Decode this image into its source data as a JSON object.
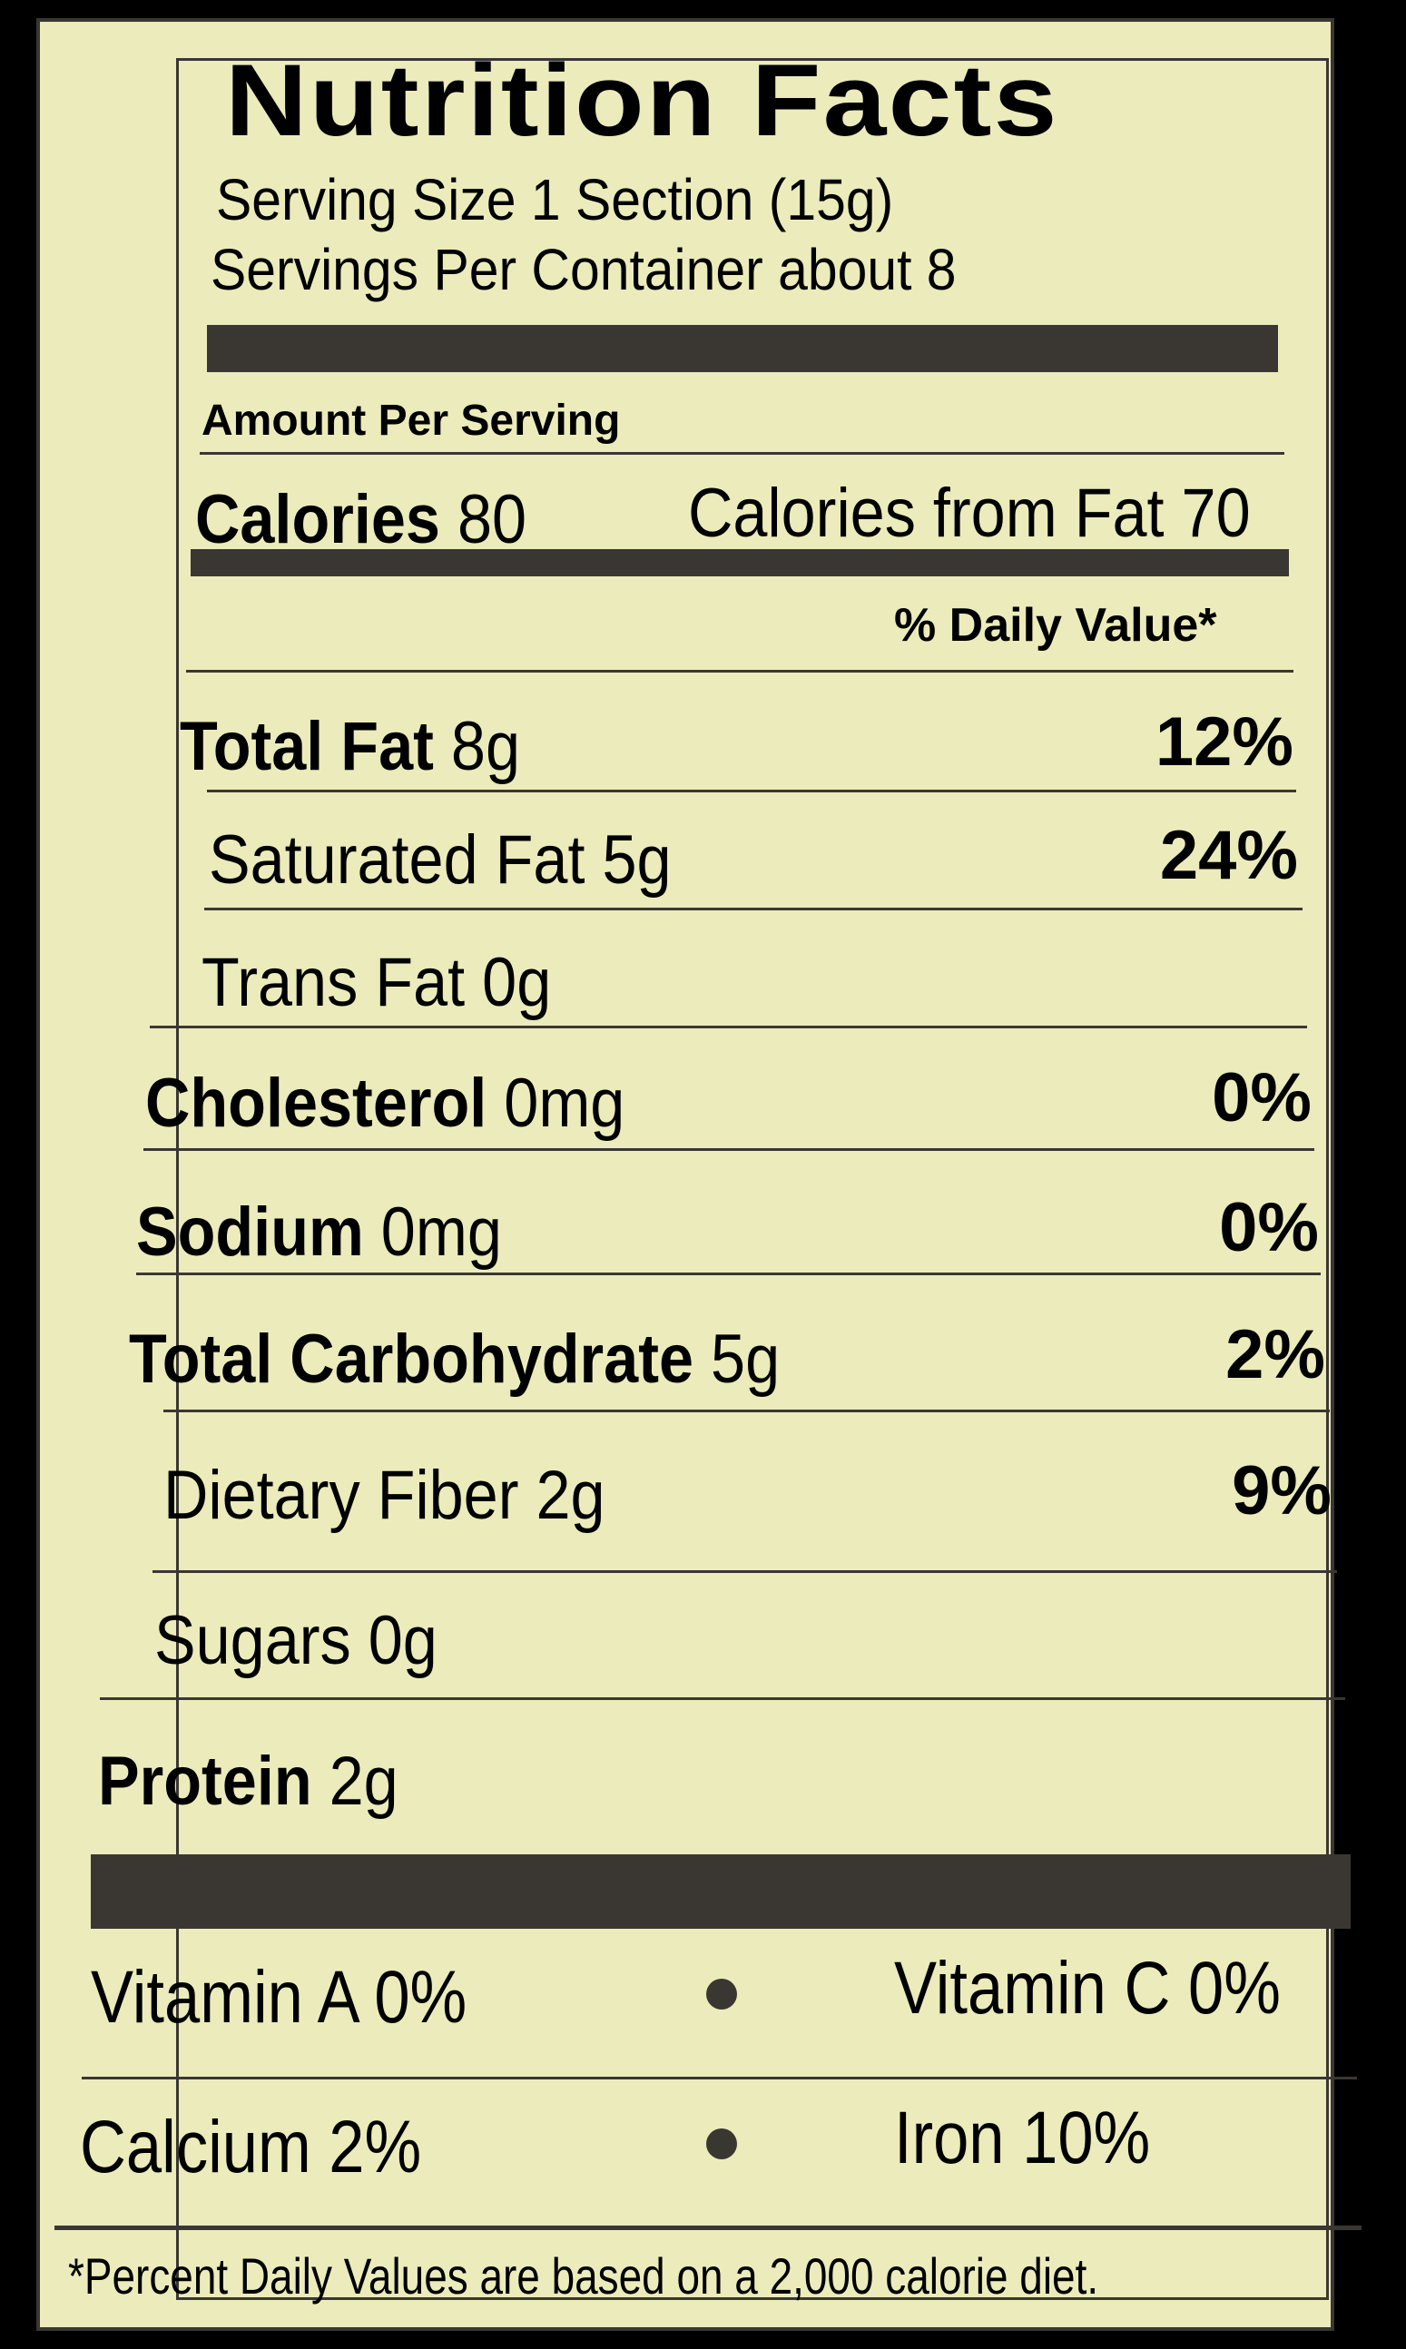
{
  "title": "Nutrition Facts",
  "serving_size": "Serving Size 1 Section (15g)",
  "servings_per_container": "Servings Per Container about 8",
  "amount_per_serving": "Amount Per Serving",
  "calories": {
    "label": "Calories",
    "value": "80"
  },
  "calories_from_fat": "Calories from Fat 70",
  "daily_value_header": "% Daily Value*",
  "nutrients": [
    {
      "label": "Total Fat",
      "amount": "8g",
      "dv": "12%"
    },
    {
      "label": "Saturated Fat",
      "amount": "5g",
      "dv": "24%"
    },
    {
      "label": "Trans Fat",
      "amount": "0g",
      "dv": ""
    },
    {
      "label": "Cholesterol",
      "amount": "0mg",
      "dv": "0%"
    },
    {
      "label": "Sodium",
      "amount": "0mg",
      "dv": "0%"
    },
    {
      "label": "Total Carbohydrate",
      "amount": "5g",
      "dv": "2%"
    },
    {
      "label": "Dietary Fiber",
      "amount": "2g",
      "dv": "9%"
    },
    {
      "label": "Sugars",
      "amount": "0g",
      "dv": ""
    },
    {
      "label": "Protein",
      "amount": "2g",
      "dv": ""
    }
  ],
  "vitamins": {
    "vitamin_a": "Vitamin A 0%",
    "vitamin_c": "Vitamin C 0%",
    "calcium": "Calcium 2%",
    "iron": "Iron 10%"
  },
  "footnote": "*Percent Daily Values are based on a 2,000 calorie diet.",
  "colors": {
    "paper": "#ecebbb",
    "ink": "#3a3733",
    "background": "#000000"
  }
}
